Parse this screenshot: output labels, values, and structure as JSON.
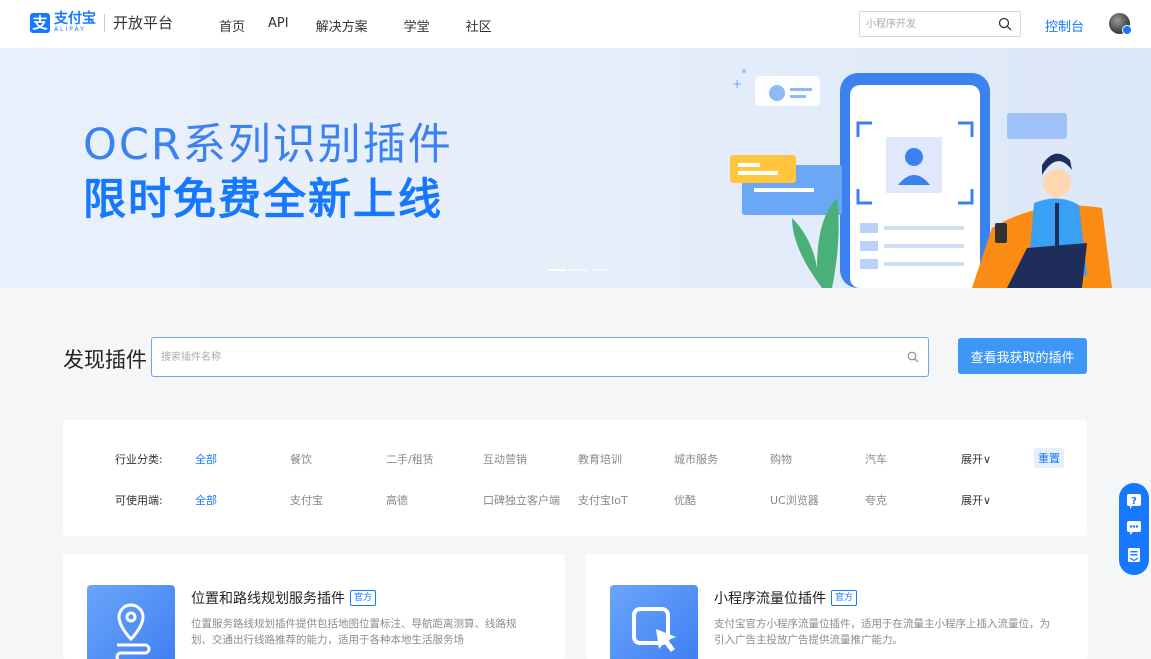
{
  "header": {
    "logo_mark": "支",
    "logo_cn": "支付宝",
    "logo_en": "ALIPAY",
    "platform": "开放平台",
    "nav": [
      "首页",
      "API",
      "解决方案",
      "学堂",
      "社区"
    ],
    "search_placeholder": "小程序开发",
    "console_label": "控制台"
  },
  "banner": {
    "line1": "OCR系列识别插件",
    "line2": "限时免费全新上线",
    "carousel_total": 3,
    "carousel_active": 1
  },
  "discover": {
    "title": "发现插件",
    "search_placeholder": "搜索插件名称",
    "my_plugins_button": "查看我获取的插件"
  },
  "filters": {
    "industry": {
      "label": "行业分类:",
      "options": [
        "全部",
        "餐饮",
        "二手/租赁",
        "互动营销",
        "教育培训",
        "城市服务",
        "购物",
        "汽车"
      ],
      "selected": "全部",
      "expand": "展开∨",
      "reset": "重置"
    },
    "platform": {
      "label": "可使用端:",
      "options": [
        "全部",
        "支付宝",
        "高德",
        "口碑独立客户端",
        "支付宝IoT",
        "优酷",
        "UC浏览器",
        "夸克"
      ],
      "selected": "全部",
      "expand": "展开∨"
    }
  },
  "plugins": [
    {
      "name": "位置和路线规划服务插件",
      "badge": "官方",
      "icon": "location-route-icon",
      "desc": "位置服务路线规划插件提供包括地图位置标注、导航距离测算、线路规划、交通出行线路推荐的能力，适用于各种本地生活服务场"
    },
    {
      "name": "小程序流量位插件",
      "badge": "官方",
      "icon": "cursor-window-icon",
      "desc": "支付宝官方小程序流量位插件，适用于在流量主小程序上插入流量位，为引入广告主投放广告提供流量推广能力。"
    }
  ],
  "colors": {
    "brand": "#1677ff",
    "banner_bg": "#e6eefa",
    "button": "#3d97f7"
  }
}
